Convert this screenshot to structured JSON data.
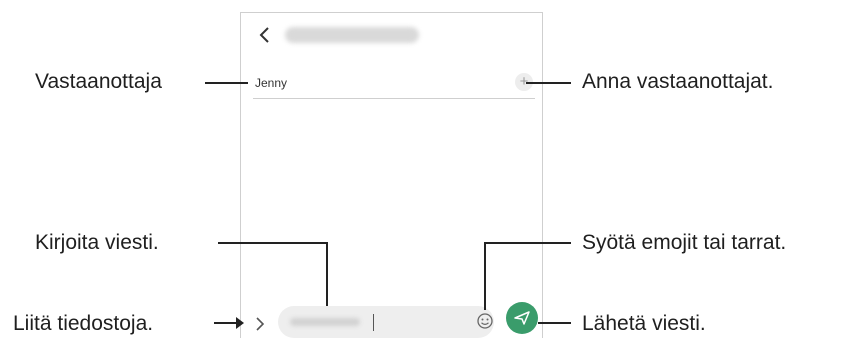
{
  "callouts": {
    "recipient": "Vastaanottaja",
    "add_recipients": "Anna vastaanottajat.",
    "write_message": "Kirjoita viesti.",
    "emoji_stickers": "Syötä emojit tai tarrat.",
    "attach_files": "Liitä tiedostoja.",
    "send_message": "Lähetä viesti."
  },
  "screen": {
    "recipient_name": "Jenny",
    "add_symbol": "+"
  },
  "colors": {
    "send_button": "#3a9c6b",
    "input_background": "#eeeeee"
  },
  "icons": [
    "back-arrow-icon",
    "add-icon",
    "expand-icon",
    "emoji-icon",
    "send-icon"
  ]
}
